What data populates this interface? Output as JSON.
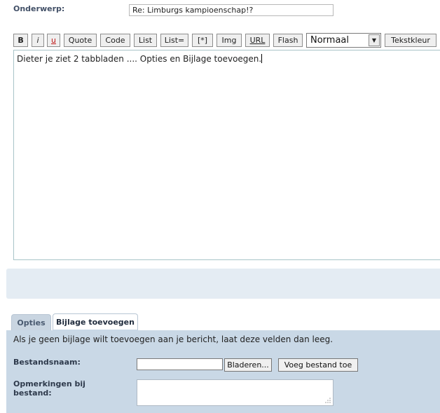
{
  "subject": {
    "label": "Onderwerp:",
    "value": "Re: Limburgs kampioenschap!?"
  },
  "toolbar": {
    "buttons": [
      "B",
      "i",
      "u",
      "Quote",
      "Code",
      "List",
      "List=",
      "[*]",
      "Img",
      "URL",
      "Flash"
    ],
    "font_size_selected": "Normaal",
    "text_color_label": "Tekstkleur"
  },
  "editor": {
    "text": "Dieter je ziet 2 tabbladen .... Opties en Bijlage toevoegen."
  },
  "tabs": [
    {
      "label": "Opties",
      "active": false
    },
    {
      "label": "Bijlage toevoegen",
      "active": true
    }
  ],
  "attachment": {
    "info": "Als je geen bijlage wilt toevoegen aan je bericht, laat deze velden dan leeg.",
    "filename_label": "Bestandsnaam:",
    "browse_label": "Bladeren...",
    "add_file_label": "Voeg bestand toe",
    "notes_label": "Opmerkingen bij bestand:"
  }
}
